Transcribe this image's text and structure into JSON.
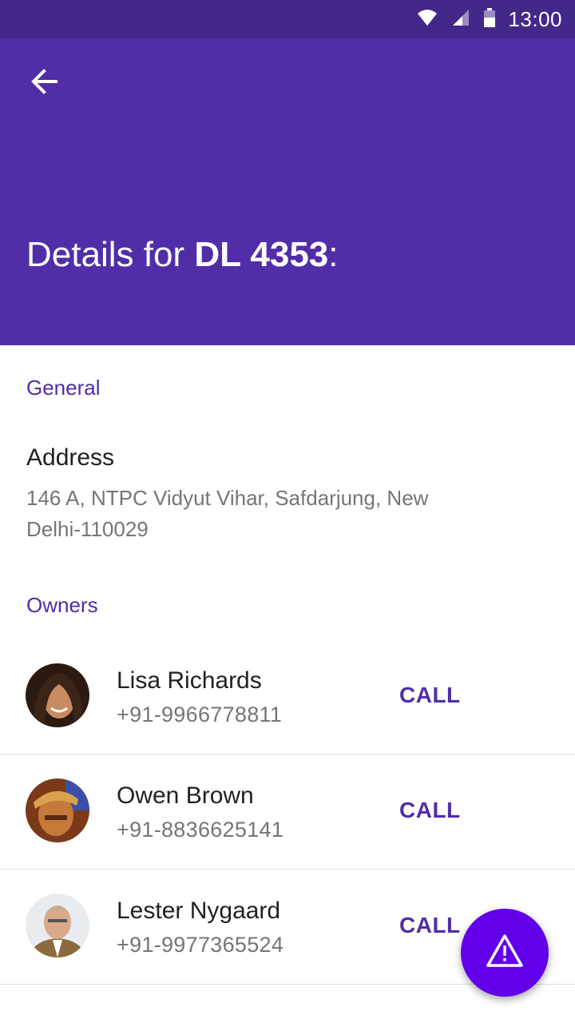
{
  "status_bar": {
    "time": "13:00",
    "icons": [
      "wifi-icon",
      "signal-icon",
      "battery-icon"
    ]
  },
  "header": {
    "back_icon": "arrow-back-icon",
    "title_prefix": "Details for",
    "title_id": "DL 4353",
    "title_suffix": ":"
  },
  "general": {
    "section_label": "General",
    "address_label": "Address",
    "address_value": "146 A, NTPC Vidyut Vihar, Safdarjung, New Delhi-110029"
  },
  "owners": {
    "section_label": "Owners",
    "items": [
      {
        "name": "Lisa Richards",
        "phone": "+91-9966778811",
        "action": "CALL"
      },
      {
        "name": "Owen Brown",
        "phone": "+91-8836625141",
        "action": "CALL"
      },
      {
        "name": "Lester Nygaard",
        "phone": "+91-9977365524",
        "action": "CALL"
      }
    ]
  },
  "fab": {
    "icon": "warning-icon"
  },
  "colors": {
    "status_bar": "#43288a",
    "app_bar": "#512da8",
    "accent": "#512da8",
    "fab": "#6200ea"
  }
}
